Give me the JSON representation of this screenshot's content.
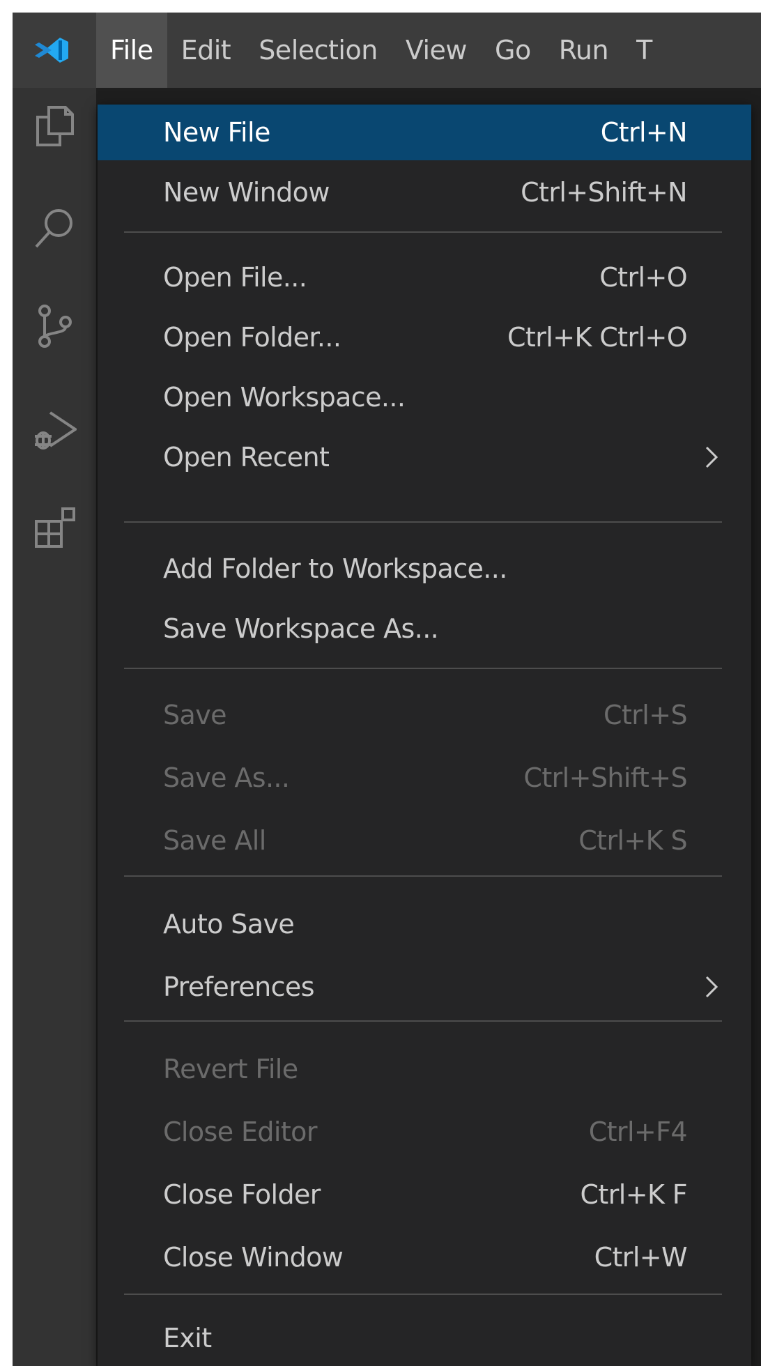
{
  "menubar": {
    "logo_icon": "vscode-logo-icon",
    "items": [
      "File",
      "Edit",
      "Selection",
      "View",
      "Go",
      "Run",
      "T"
    ],
    "active_index": 0
  },
  "activitybar": {
    "icons": [
      "explorer-icon",
      "search-icon",
      "source-control-icon",
      "run-debug-icon",
      "extensions-icon"
    ]
  },
  "file_menu": {
    "items": [
      {
        "label": "New File",
        "shortcut": "Ctrl+N",
        "state": "selected"
      },
      {
        "label": "New Window",
        "shortcut": "Ctrl+Shift+N",
        "state": "enabled"
      },
      {
        "label": "Open File...",
        "shortcut": "Ctrl+O",
        "state": "enabled"
      },
      {
        "label": "Open Folder...",
        "shortcut": "Ctrl+K Ctrl+O",
        "state": "enabled"
      },
      {
        "label": "Open Workspace...",
        "shortcut": "",
        "state": "enabled"
      },
      {
        "label": "Open Recent",
        "shortcut": "",
        "state": "enabled",
        "submenu": true
      },
      {
        "label": "Add Folder to Workspace...",
        "shortcut": "",
        "state": "enabled"
      },
      {
        "label": "Save Workspace As...",
        "shortcut": "",
        "state": "enabled"
      },
      {
        "label": "Save",
        "shortcut": "Ctrl+S",
        "state": "disabled"
      },
      {
        "label": "Save As...",
        "shortcut": "Ctrl+Shift+S",
        "state": "disabled"
      },
      {
        "label": "Save All",
        "shortcut": "Ctrl+K S",
        "state": "disabled"
      },
      {
        "label": "Auto Save",
        "shortcut": "",
        "state": "enabled"
      },
      {
        "label": "Preferences",
        "shortcut": "",
        "state": "enabled",
        "submenu": true
      },
      {
        "label": "Revert File",
        "shortcut": "",
        "state": "disabled"
      },
      {
        "label": "Close Editor",
        "shortcut": "Ctrl+F4",
        "state": "disabled"
      },
      {
        "label": "Close Folder",
        "shortcut": "Ctrl+K F",
        "state": "enabled"
      },
      {
        "label": "Close Window",
        "shortcut": "Ctrl+W",
        "state": "enabled"
      },
      {
        "label": "Exit",
        "shortcut": "",
        "state": "enabled"
      }
    ]
  },
  "colors": {
    "menubar_bg": "#3c3c3c",
    "activitybar_bg": "#333333",
    "menu_bg": "#252526",
    "selection_bg": "#094771",
    "text": "#cccccc",
    "disabled_text": "#6b6b6b",
    "logo_blue": "#23a9f2"
  }
}
